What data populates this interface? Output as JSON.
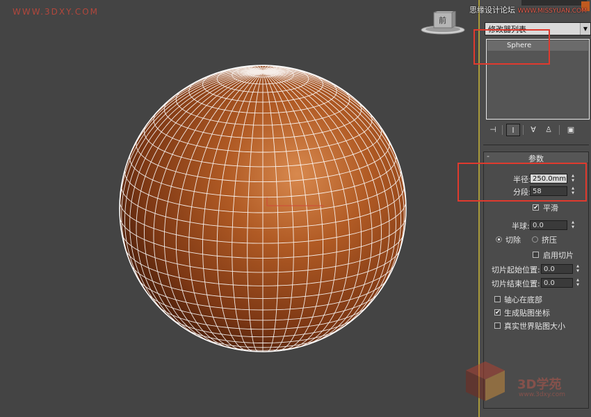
{
  "watermarks": {
    "top_left": "WWW.3DXY.COM",
    "top_right_cn": "思缘设计论坛",
    "top_right_url": "WWW.MISSYUAN.COM",
    "bottom_right_text": "3D学苑",
    "bottom_right_url": "www.3dxy.com"
  },
  "viewport": {
    "viewcube_label": "前",
    "object_color": "#a8501f",
    "wire_color": "#ffffff",
    "segments": 58
  },
  "modifier_panel": {
    "modifier_list_label": "修改器列表",
    "stack_items": [
      "Sphere"
    ]
  },
  "stack_toolbar": [
    "pin-stack-icon",
    "show-end-result-icon",
    "make-unique-icon",
    "remove-modifier-icon",
    "configure-modifier-sets-icon"
  ],
  "parameters": {
    "title": "参数",
    "radius_label": "半径:",
    "radius_value": "250.0mm",
    "segments_label": "分段:",
    "segments_value": "58",
    "smooth_label": "平滑",
    "smooth_checked": true,
    "hemisphere_label": "半球:",
    "hemisphere_value": "0.0",
    "chop_label": "切除",
    "squash_label": "挤压",
    "hemisphere_mode": "chop",
    "enable_slice_label": "启用切片",
    "enable_slice_checked": false,
    "slice_from_label": "切片起始位置:",
    "slice_from_value": "0.0",
    "slice_to_label": "切片结束位置:",
    "slice_to_value": "0.0",
    "base_to_pivot_label": "轴心在底部",
    "base_to_pivot_checked": false,
    "gen_mapping_label": "生成贴图坐标",
    "gen_mapping_checked": true,
    "real_world_label": "真实世界贴图大小",
    "real_world_checked": false
  },
  "colors": {
    "highlight_box": "#e03a2e",
    "viewport_bg": "#444444",
    "panel_bg": "#4b4b4b"
  }
}
